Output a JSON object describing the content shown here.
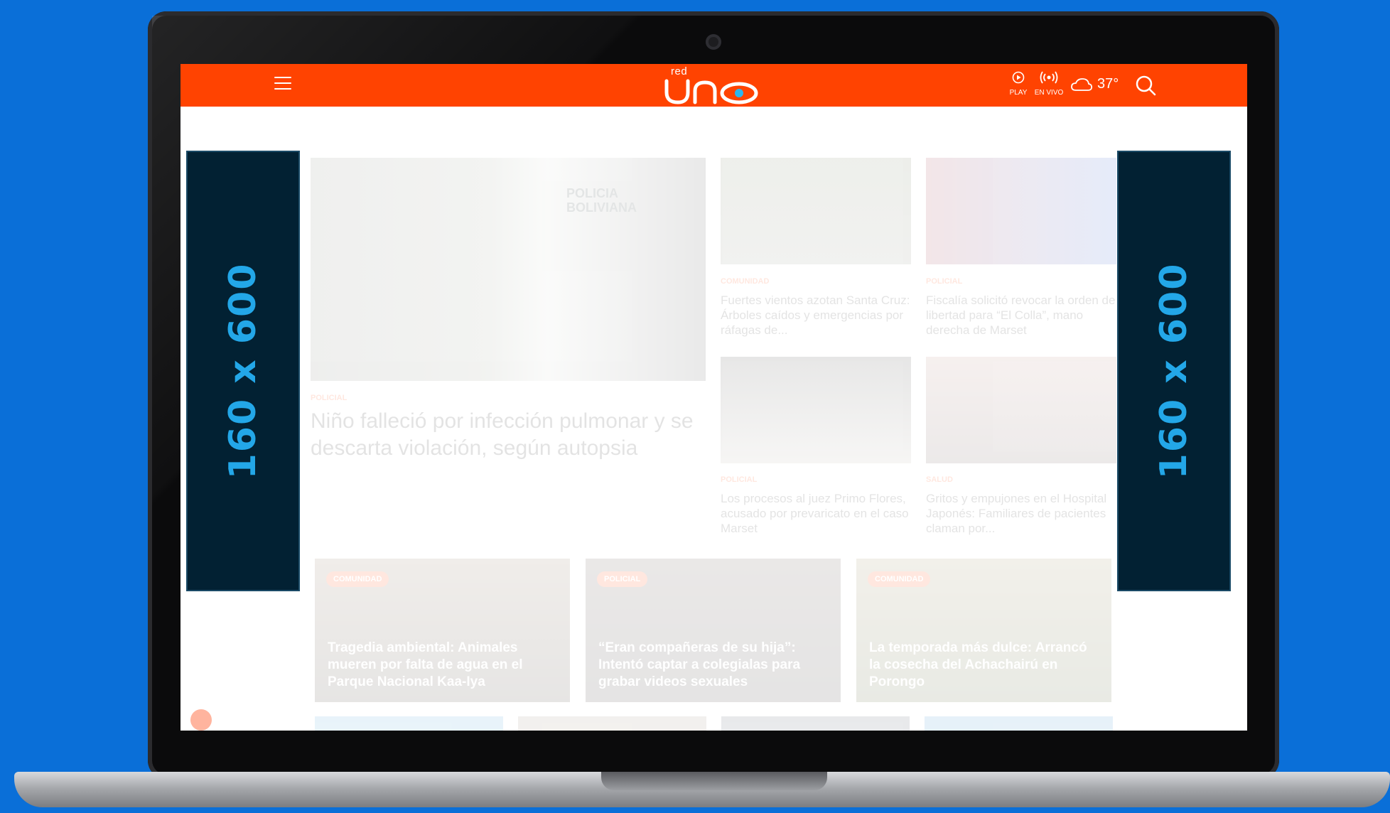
{
  "header": {
    "logo_small": "red",
    "logo_main": "uno",
    "play_label": "PLAY",
    "live_label": "EN VIVO",
    "temperature": "37°"
  },
  "ads": {
    "left_label": "160 x 600",
    "right_label": "160 x 600"
  },
  "main_story": {
    "category": "POLICIAL",
    "title": "Niño falleció por infección pulmonar y se descarta violación, según autopsia",
    "sign_text": "POLICIA BOLIVIANA"
  },
  "side_stories": [
    {
      "category": "COMUNIDAD",
      "title": "Fuertes vientos azotan Santa Cruz: Árboles caídos y emergencias por ráfagas de..."
    },
    {
      "category": "POLICIAL",
      "title": "Fiscalía solicitó revocar la orden de libertad para “El Colla”, mano derecha de Marset"
    },
    {
      "category": "POLICIAL",
      "title": "Los procesos al juez Primo Flores, acusado por prevaricato en el caso Marset"
    },
    {
      "category": "SALUD",
      "title": "Gritos y empujones en el Hospital Japonés: Familiares de pacientes claman por..."
    }
  ],
  "cards": [
    {
      "category": "COMUNIDAD",
      "title": "Tragedia ambiental: Animales mueren por falta de agua en el Parque Nacional Kaa-Iya"
    },
    {
      "category": "POLICIAL",
      "title": "“Eran compañeras de su hija”: Intentó captar a colegialas para grabar videos sexuales"
    },
    {
      "category": "COMUNIDAD",
      "title": "La temporada más dulce: Arrancó la cosecha del Achachairú en Porongo"
    }
  ],
  "colors": {
    "brand": "#ff4301",
    "ad_bg": "#022133",
    "ad_text": "#23a7e8",
    "backdrop": "#0a6fd8"
  }
}
